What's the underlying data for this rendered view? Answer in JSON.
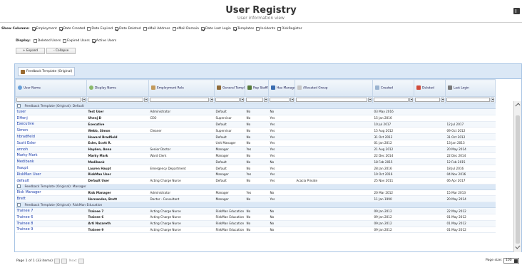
{
  "header": {
    "title": "User Registry",
    "subtitle": "User information view"
  },
  "show_columns": {
    "label": "Show Columns:",
    "options": [
      {
        "label": "Employment",
        "checked": true
      },
      {
        "label": "Date Created",
        "checked": true
      },
      {
        "label": "Date Expired",
        "checked": false
      },
      {
        "label": "Date Deleted",
        "checked": true
      },
      {
        "label": "eMail Address",
        "checked": false
      },
      {
        "label": "eMail Domain",
        "checked": false
      },
      {
        "label": "Date Last Login",
        "checked": true
      },
      {
        "label": "Templates",
        "checked": true
      },
      {
        "label": "Incidents",
        "checked": false
      },
      {
        "label": "RiskRegister",
        "checked": false
      }
    ]
  },
  "display": {
    "label": "Display:",
    "options": [
      {
        "label": "Deleted Users",
        "checked": false
      },
      {
        "label": "Expired Users",
        "checked": false
      },
      {
        "label": "Active Users",
        "checked": true
      }
    ]
  },
  "buttons": {
    "expand": "+ Expand",
    "collapse": "- Collapse"
  },
  "grid": {
    "toolbar_button": "Feedback Template (Original)",
    "columns": [
      {
        "label": "User Name",
        "icon": "user-icon"
      },
      {
        "label": "Display Name",
        "icon": "display-name-icon"
      },
      {
        "label": "Employment Role",
        "icon": "employment-icon"
      },
      {
        "label": "General Templ",
        "icon": "template-icon"
      },
      {
        "label": "Rep Staff?",
        "icon": "staff-icon"
      },
      {
        "label": "Has Manage",
        "icon": "manager-icon"
      },
      {
        "label": "Allocated Group",
        "icon": "group-icon"
      },
      {
        "label": "Created",
        "icon": "calendar-icon"
      },
      {
        "label": "Deleted",
        "icon": "delete-icon"
      },
      {
        "label": "Last Login",
        "icon": "login-icon"
      }
    ],
    "groups": [
      {
        "label": "Feedback Template (Original): Default",
        "rows": [
          [
            "tuser",
            "Test User",
            "Administrator",
            "Default",
            "No",
            "No",
            "",
            "03 May 2016",
            "",
            ""
          ],
          [
            "DHenj",
            "Uhenj D",
            "CEO",
            "Supervisor",
            "No",
            "Yes",
            "",
            "15 Jan 2016",
            "",
            ""
          ],
          [
            "Executive",
            "Executive",
            "",
            "Default",
            "No",
            "Yes",
            "",
            "10 Jul 2017",
            "",
            "12 Jul 2017"
          ],
          [
            "Simon",
            "Webb, Simon",
            "Cleaner",
            "Supervisor",
            "No",
            "Yes",
            "",
            "15 Aug 2012",
            "",
            "09 Oct 2012"
          ],
          [
            "hbradfield",
            "Howard Bradfield",
            "",
            "Default",
            "No",
            "Yes",
            "",
            "31 Oct 2012",
            "",
            "31 Oct 2012"
          ],
          [
            "Scott Esler",
            "Esler, Scott R.",
            "",
            "Unit Manager",
            "No",
            "Yes",
            "",
            "01 Jan 2012",
            "",
            "13 Jan 2013"
          ],
          [
            "annoh",
            "Hayden, Anna",
            "Senior Doctor",
            "Manager",
            "Yes",
            "Yes",
            "",
            "21 Aug 2012",
            "",
            "20 May 2014"
          ],
          [
            "Marky Mark",
            "Marky Mark",
            "Ward Clerk",
            "Manager",
            "No",
            "Yes",
            "",
            "22 Dec 2014",
            "",
            "22 Dec 2014"
          ],
          [
            "Medibank",
            "Medibank",
            "",
            "Default",
            "No",
            "No",
            "",
            "18 Feb 2015",
            "",
            "12 Feb 2015"
          ],
          [
            "lhaupt",
            "Lauren Haupt",
            "Emergency Department",
            "Default",
            "No",
            "Yes",
            "",
            "28 Jan 2016",
            "",
            "18 Jul 2016"
          ],
          [
            "RiskMan User",
            "RiskMan User",
            "",
            "Manager",
            "Yes",
            "Yes",
            "",
            "19 Oct 2016",
            "",
            "04 Nov 2016"
          ],
          [
            "default",
            "Default User",
            "Acting Charge Nurse",
            "Default",
            "No",
            "Yes",
            "Acacia Private",
            "25 Nov 2011",
            "",
            "06 Apr 2017"
          ]
        ]
      },
      {
        "label": "Feedback Template (Original): Manager",
        "rows": [
          [
            "Risk Manager",
            "Risk Manager",
            "Administrator",
            "Manager",
            "Yes",
            "No",
            "",
            "20 Mar 2012",
            "",
            "15 Mar 2013"
          ],
          [
            "Brett",
            "Hernandez, Brett",
            "Doctor - Consultant",
            "Manager",
            "No",
            "Yes",
            "",
            "11 Jan 1990",
            "",
            "20 May 2014"
          ]
        ]
      },
      {
        "label": "Feedback Template (Original): RiskMan Education",
        "rows": [
          [
            "Trainee 7",
            "Trainee 7",
            "Acting Charge Nurse",
            "RiskMan Education",
            "No",
            "No",
            "",
            "09 Jan 2012",
            "",
            "22 May 2012"
          ],
          [
            "Trainee 6",
            "Trainee 6",
            "Acting Charge Nurse",
            "RiskMan Education",
            "No",
            "No",
            "",
            "09 Jan 2012",
            "",
            "01 May 2012"
          ],
          [
            "Trainee 8",
            "Arti Nazareth",
            "Acting Charge Nurse",
            "RiskMan Education",
            "No",
            "No",
            "",
            "09 Jan 2012",
            "",
            "01 May 2012"
          ],
          [
            "Trainee 9",
            "Trainee 9",
            "Acting Charge Nurse",
            "RiskMan Education",
            "No",
            "No",
            "",
            "09 Jan 2012",
            "",
            "01 May 2012"
          ]
        ]
      }
    ]
  },
  "pager": {
    "text": "Page 1 of 1 (33 items)",
    "next": "Next",
    "page_size_label": "Page size:",
    "page_size_value": "100"
  }
}
